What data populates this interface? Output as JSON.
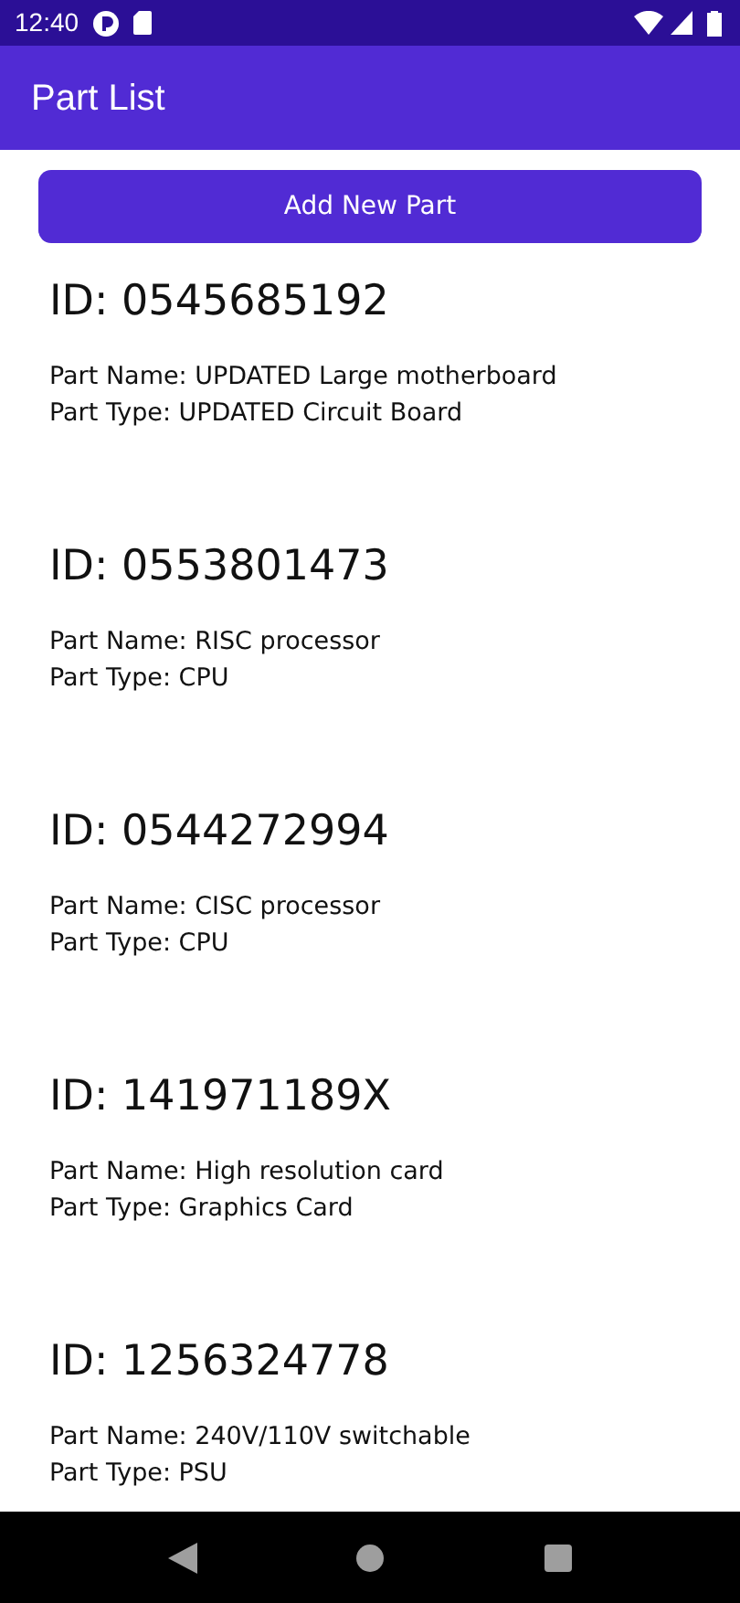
{
  "status_bar": {
    "time": "12:40"
  },
  "app_bar": {
    "title": "Part List"
  },
  "add_button": {
    "label": "Add New Part"
  },
  "parts": [
    {
      "id": "ID: 0545685192",
      "name": "Part Name: UPDATED Large motherboard",
      "type": "Part Type: UPDATED Circuit Board"
    },
    {
      "id": "ID: 0553801473",
      "name": "Part Name: RISC processor",
      "type": "Part Type: CPU"
    },
    {
      "id": "ID: 0544272994",
      "name": "Part Name: CISC processor",
      "type": "Part Type: CPU"
    },
    {
      "id": "ID: 141971189X",
      "name": "Part Name: High resolution card",
      "type": "Part Type: Graphics Card"
    },
    {
      "id": "ID: 1256324778",
      "name": "Part Name: 240V/110V switchable",
      "type": "Part Type: PSU"
    }
  ]
}
